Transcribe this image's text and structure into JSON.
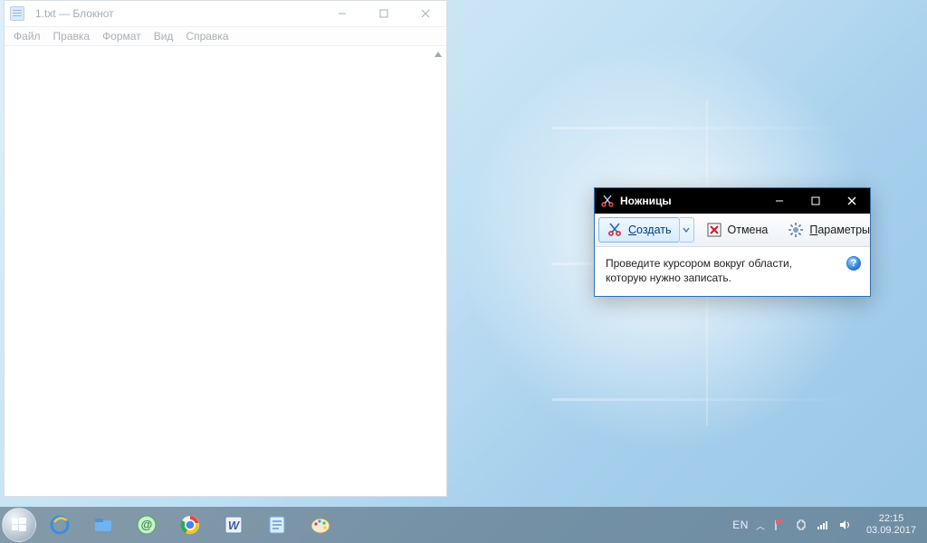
{
  "notepad": {
    "title": "1.txt — Блокнот",
    "menu": {
      "file": "Файл",
      "edit": "Правка",
      "format": "Формат",
      "view": "Вид",
      "help": "Справка"
    }
  },
  "snip": {
    "title": "Ножницы",
    "toolbar": {
      "create_prefix": "С",
      "create_rest": "оздать",
      "cancel": "Отмена",
      "options_prefix": "П",
      "options_rest": "араметры"
    },
    "hint": "Проведите курсором вокруг области, которую нужно записать.",
    "help_glyph": "?"
  },
  "taskbar": {
    "lang": "EN",
    "chevron": "︿",
    "time": "22:15",
    "date": "03.09.2017"
  }
}
